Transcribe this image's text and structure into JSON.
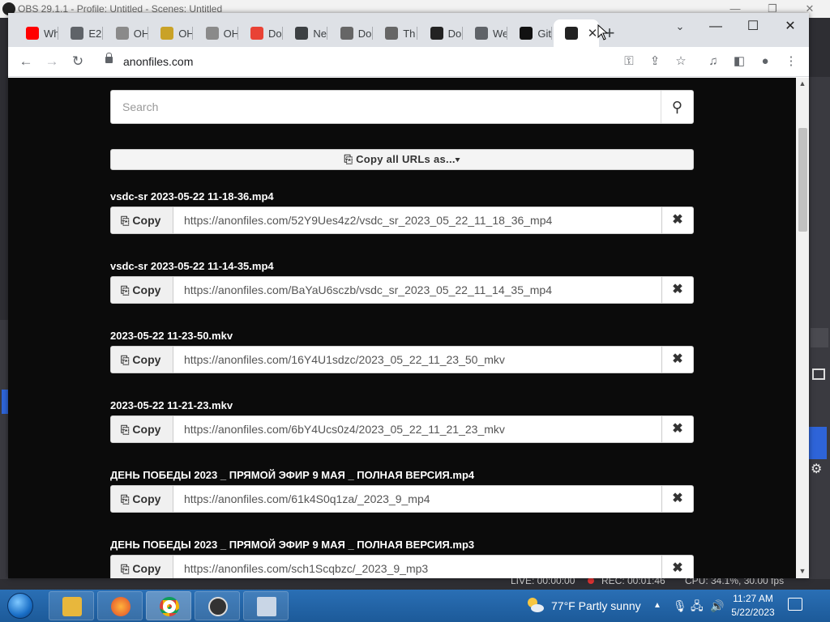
{
  "obs": {
    "title": "OBS 29.1.1 - Profile: Untitled - Scenes: Untitled",
    "status": {
      "live": "LIVE: 00:00:00",
      "rec": "REC: 00:01:46",
      "cpu": "CPU: 34.1%, 30.00 fps"
    }
  },
  "browser": {
    "tabs": [
      {
        "label": "Wh",
        "favicon": "youtube-icon",
        "color": "#ff0000"
      },
      {
        "label": "E2(",
        "favicon": "globe-icon",
        "color": "#5f6368"
      },
      {
        "label": "OH",
        "favicon": "circle-icon",
        "color": "#8a8a8a"
      },
      {
        "label": "OH",
        "favicon": "square-icon",
        "color": "#c9a227"
      },
      {
        "label": "OH",
        "favicon": "circle-icon",
        "color": "#8a8a8a"
      },
      {
        "label": "Do",
        "favicon": "pinwheel-icon",
        "color": "#e94235"
      },
      {
        "label": "Ne",
        "favicon": "globe-icon",
        "color": "#3c4043"
      },
      {
        "label": "Do",
        "favicon": "leaf-icon",
        "color": "#666"
      },
      {
        "label": "Th",
        "favicon": "leaf-icon",
        "color": "#666"
      },
      {
        "label": "Do",
        "favicon": "obs-icon",
        "color": "#222"
      },
      {
        "label": "We",
        "favicon": "globe-icon",
        "color": "#5f6368"
      },
      {
        "label": "Git",
        "favicon": "github-icon",
        "color": "#111"
      },
      {
        "label": "",
        "favicon": "anonfiles-icon",
        "color": "#222",
        "active": true
      }
    ],
    "url": "anonfiles.com"
  },
  "page": {
    "search_placeholder": "Search",
    "copy_all_label": "Copy all URLs as...",
    "copy_label": "Copy",
    "files": [
      {
        "name": "vsdc-sr 2023-05-22 11-18-36.mp4",
        "url": "https://anonfiles.com/52Y9Ues4z2/vsdc_sr_2023_05_22_11_18_36_mp4"
      },
      {
        "name": "vsdc-sr 2023-05-22 11-14-35.mp4",
        "url": "https://anonfiles.com/BaYaU6sczb/vsdc_sr_2023_05_22_11_14_35_mp4"
      },
      {
        "name": "2023-05-22 11-23-50.mkv",
        "url": "https://anonfiles.com/16Y4U1sdzc/2023_05_22_11_23_50_mkv"
      },
      {
        "name": "2023-05-22 11-21-23.mkv",
        "url": "https://anonfiles.com/6bY4Ucs0z4/2023_05_22_11_21_23_mkv"
      },
      {
        "name": "ДЕНЬ ПОБЕДЫ 2023 _ ПРЯМОЙ ЭФИР 9 МАЯ _ ПОЛНАЯ ВЕРСИЯ.mp4",
        "url": "https://anonfiles.com/61k4S0q1za/_2023_9_mp4"
      },
      {
        "name": "ДЕНЬ ПОБЕДЫ 2023 _ ПРЯМОЙ ЭФИР 9 МАЯ _ ПОЛНАЯ ВЕРСИЯ.mp3",
        "url": "https://anonfiles.com/sch1Scqbzc/_2023_9_mp3"
      }
    ]
  },
  "taskbar": {
    "weather": "77°F  Partly sunny",
    "time": "11:27 AM",
    "date": "5/22/2023"
  }
}
